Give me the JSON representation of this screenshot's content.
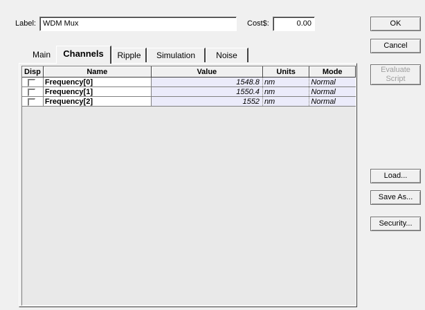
{
  "label": {
    "caption": "Label:",
    "value": "WDM Mux"
  },
  "cost": {
    "caption": "Cost$:",
    "value": "0.00"
  },
  "tabs": [
    {
      "label": "Main",
      "active": false
    },
    {
      "label": "Channels",
      "active": true
    },
    {
      "label": "Ripple",
      "active": false
    },
    {
      "label": "Simulation",
      "active": false
    },
    {
      "label": "Noise",
      "active": false
    }
  ],
  "buttons": {
    "ok": "OK",
    "cancel": "Cancel",
    "evaluate_line1": "Evaluate",
    "evaluate_line2": "Script",
    "load": "Load...",
    "save_as": "Save As...",
    "security": "Security..."
  },
  "table": {
    "headers": {
      "disp": "Disp",
      "name": "Name",
      "value": "Value",
      "units": "Units",
      "mode": "Mode"
    },
    "rows": [
      {
        "disp": false,
        "name": "Frequency[0]",
        "value": "1548.8",
        "units": "nm",
        "mode": "Normal"
      },
      {
        "disp": false,
        "name": "Frequency[1]",
        "value": "1550.4",
        "units": "nm",
        "mode": "Normal"
      },
      {
        "disp": false,
        "name": "Frequency[2]",
        "value": "1552",
        "units": "nm",
        "mode": "Normal"
      }
    ]
  }
}
